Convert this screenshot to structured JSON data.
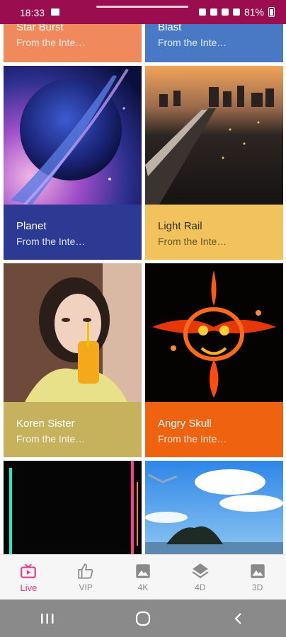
{
  "status_bar": {
    "time": "18:33",
    "battery": "81%"
  },
  "tiles": [
    {
      "title": "Star Burst",
      "subtitle": "From the Inte…",
      "color": "#f08a5d",
      "art": "star-burst-image"
    },
    {
      "title": "Blast",
      "subtitle": "From the Inte…",
      "color": "#4978c5",
      "art": "blast-image"
    },
    {
      "title": "Planet",
      "subtitle": "From the Inte…",
      "color": "#2d3a94",
      "art": "planet-image"
    },
    {
      "title": "Light Rail",
      "subtitle": "From the Inte…",
      "color": "#f2c35c",
      "art": "light-rail-image"
    },
    {
      "title": "Koren Sister",
      "subtitle": "From the Inte…",
      "color": "#c6b25c",
      "art": "woman-drinking-image"
    },
    {
      "title": "Angry Skull",
      "subtitle": "From the Inte…",
      "color": "#ef6210",
      "art": "fire-skull-image"
    }
  ],
  "bottom_nav": {
    "items": [
      {
        "label": "Live",
        "icon": "tv-icon",
        "active": true
      },
      {
        "label": "VIP",
        "icon": "thumbs-up-icon",
        "active": false
      },
      {
        "label": "4K",
        "icon": "image-icon",
        "active": false
      },
      {
        "label": "4D",
        "icon": "layers-icon",
        "active": false
      },
      {
        "label": "3D",
        "icon": "image-icon",
        "active": false
      }
    ],
    "active_color": "#e83c8a",
    "inactive_color": "#8a8a8a"
  },
  "system_nav": {
    "buttons": [
      "recent-apps-icon",
      "home-icon",
      "back-icon"
    ]
  }
}
